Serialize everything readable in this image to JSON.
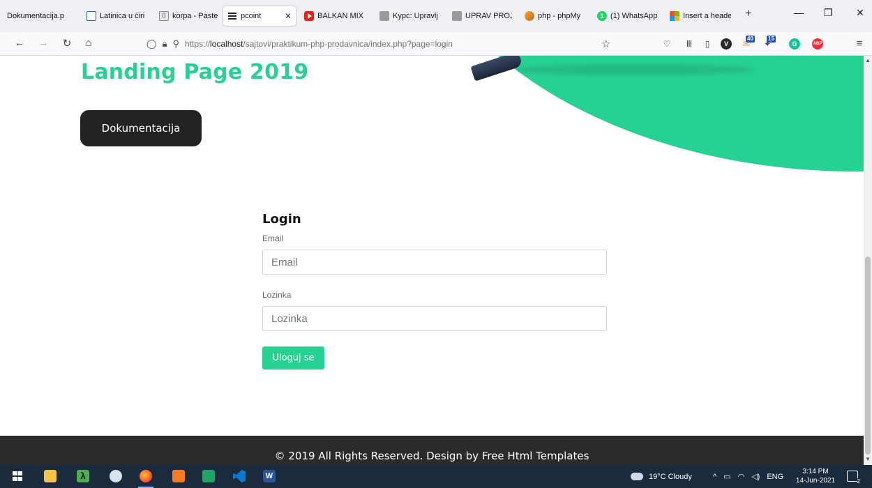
{
  "browser": {
    "tabs": [
      {
        "title": "Dokumentacija.p",
        "icon": "document-icon"
      },
      {
        "title": "Latinica u ćiri",
        "icon": "book-icon"
      },
      {
        "title": "korpa - Paste",
        "icon": "pastebin-icon"
      },
      {
        "title": "pcoint",
        "icon": "menu-lines-icon",
        "active": true
      },
      {
        "title": "BALKAN MIX",
        "icon": "youtube-icon"
      },
      {
        "title": "Kypc: Upravlj",
        "icon": "course-icon"
      },
      {
        "title": "UPRAV PROJ",
        "icon": "course-icon"
      },
      {
        "title": "php - phpMy",
        "icon": "phpmyadmin-icon"
      },
      {
        "title": "(1) WhatsApp",
        "icon": "whatsapp-icon"
      },
      {
        "title": "Insert a heade",
        "icon": "microsoft-icon"
      }
    ],
    "new_tab_label": "+",
    "close_tab_label": "✕",
    "window_controls": {
      "minimize": "—",
      "restore": "❐",
      "close": "✕"
    },
    "url": {
      "scheme": "https://",
      "host": "localhost",
      "path": "/sajtovi/praktikum-php-prodavnica/index.php?page=login"
    },
    "extensions": [
      {
        "name": "pocket-icon",
        "glyph": "♡"
      },
      {
        "name": "library-icon",
        "glyph": "Ⅲ"
      },
      {
        "name": "sidebar-icon",
        "glyph": "▯"
      },
      {
        "name": "vpn-icon",
        "glyph": "V"
      },
      {
        "name": "extension-icon",
        "glyph": "✉",
        "badge": "40"
      },
      {
        "name": "extension-icon",
        "glyph": "✦",
        "badge": "15"
      },
      {
        "name": "grammarly-icon",
        "glyph": "G"
      },
      {
        "name": "adblock-icon",
        "glyph": "ABP"
      },
      {
        "name": "menu-icon",
        "glyph": "≡"
      }
    ]
  },
  "page": {
    "hero": {
      "title": "Landing Page 2019",
      "button_label": "Dokumentacija"
    },
    "login": {
      "heading": "Login",
      "email_label": "Email",
      "email_placeholder": "Email",
      "password_label": "Lozinka",
      "password_placeholder": "Lozinka",
      "submit_label": "Uloguj se"
    },
    "footer": {
      "text": "© 2019 All Rights Reserved. Design by Free Html Templates"
    }
  },
  "taskbar": {
    "weather": "19°C  Cloudy",
    "tray_chevron": "^",
    "language": "ENG",
    "time": "3:14 PM",
    "date": "14-Jun-2021",
    "notification_count": "2",
    "apps": [
      "start",
      "file-explorer",
      "lambda",
      "steam",
      "firefox",
      "xampp",
      "sheets",
      "vscode",
      "word"
    ]
  },
  "colors": {
    "accent": "#27d192",
    "dark_button": "#232323",
    "footer_bg": "#292b2c",
    "taskbar_bg": "#1b2a3d"
  }
}
